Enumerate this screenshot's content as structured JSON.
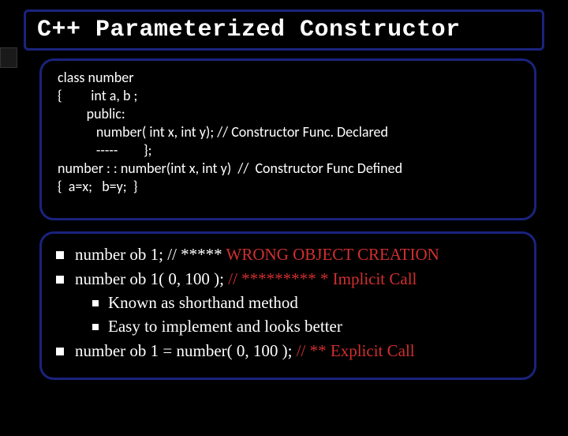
{
  "title": "C++ Parameterized Constructor",
  "code": {
    "l1": "class number",
    "l2": "{         int a, b ;",
    "l3": "         public:",
    "l4": "            number( int x, int y); // Constructor Func. Declared",
    "l5": "            -----        };",
    "l6": "number : : number(int x, int y)  //  Constructor Func Defined",
    "l7": "{  a=x;   b=y;  }"
  },
  "notes": {
    "n1a": "number ob 1; // ***** ",
    "n1b": " WRONG OBJECT CREATION",
    "n2a": "number  ob 1( 0, 100 ); ",
    "n2b": "// ********* * Implicit Call",
    "n2s1": "Known as shorthand method",
    "n2s2": "Easy to implement and looks better",
    "n3a": "number  ob 1 = number( 0, 100 ); ",
    "n3b": "// **  Explicit Call"
  }
}
